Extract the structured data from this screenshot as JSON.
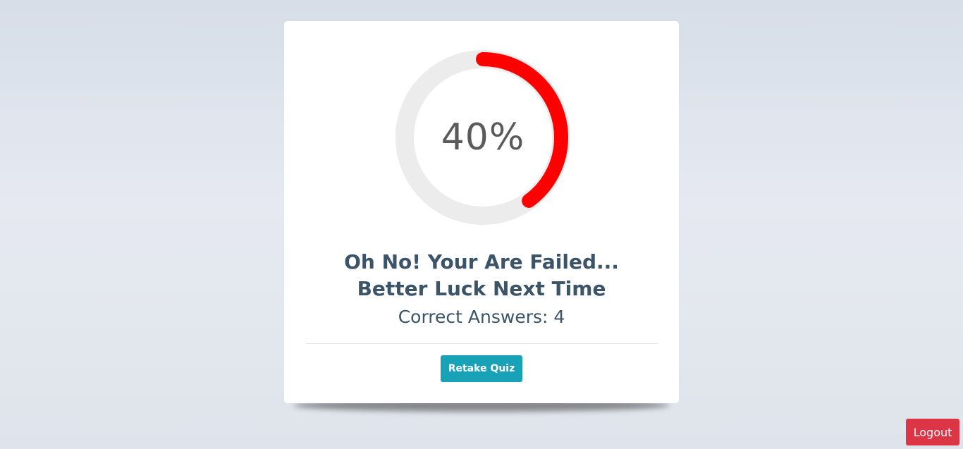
{
  "result": {
    "percent_value": 40,
    "percent_label": "40%",
    "headline_line1": "Oh No! Your Are Failed...",
    "headline_line2": "Better Luck Next Time",
    "correct_answers": "Correct Answers: 4"
  },
  "actions": {
    "retake_label": "Retake Quiz",
    "logout_label": "Logout"
  },
  "colors": {
    "progress_fill": "#ff0000",
    "progress_track": "#ececec",
    "accent": "#17a2b8",
    "danger": "#dc3545",
    "text": "#3b5468"
  }
}
